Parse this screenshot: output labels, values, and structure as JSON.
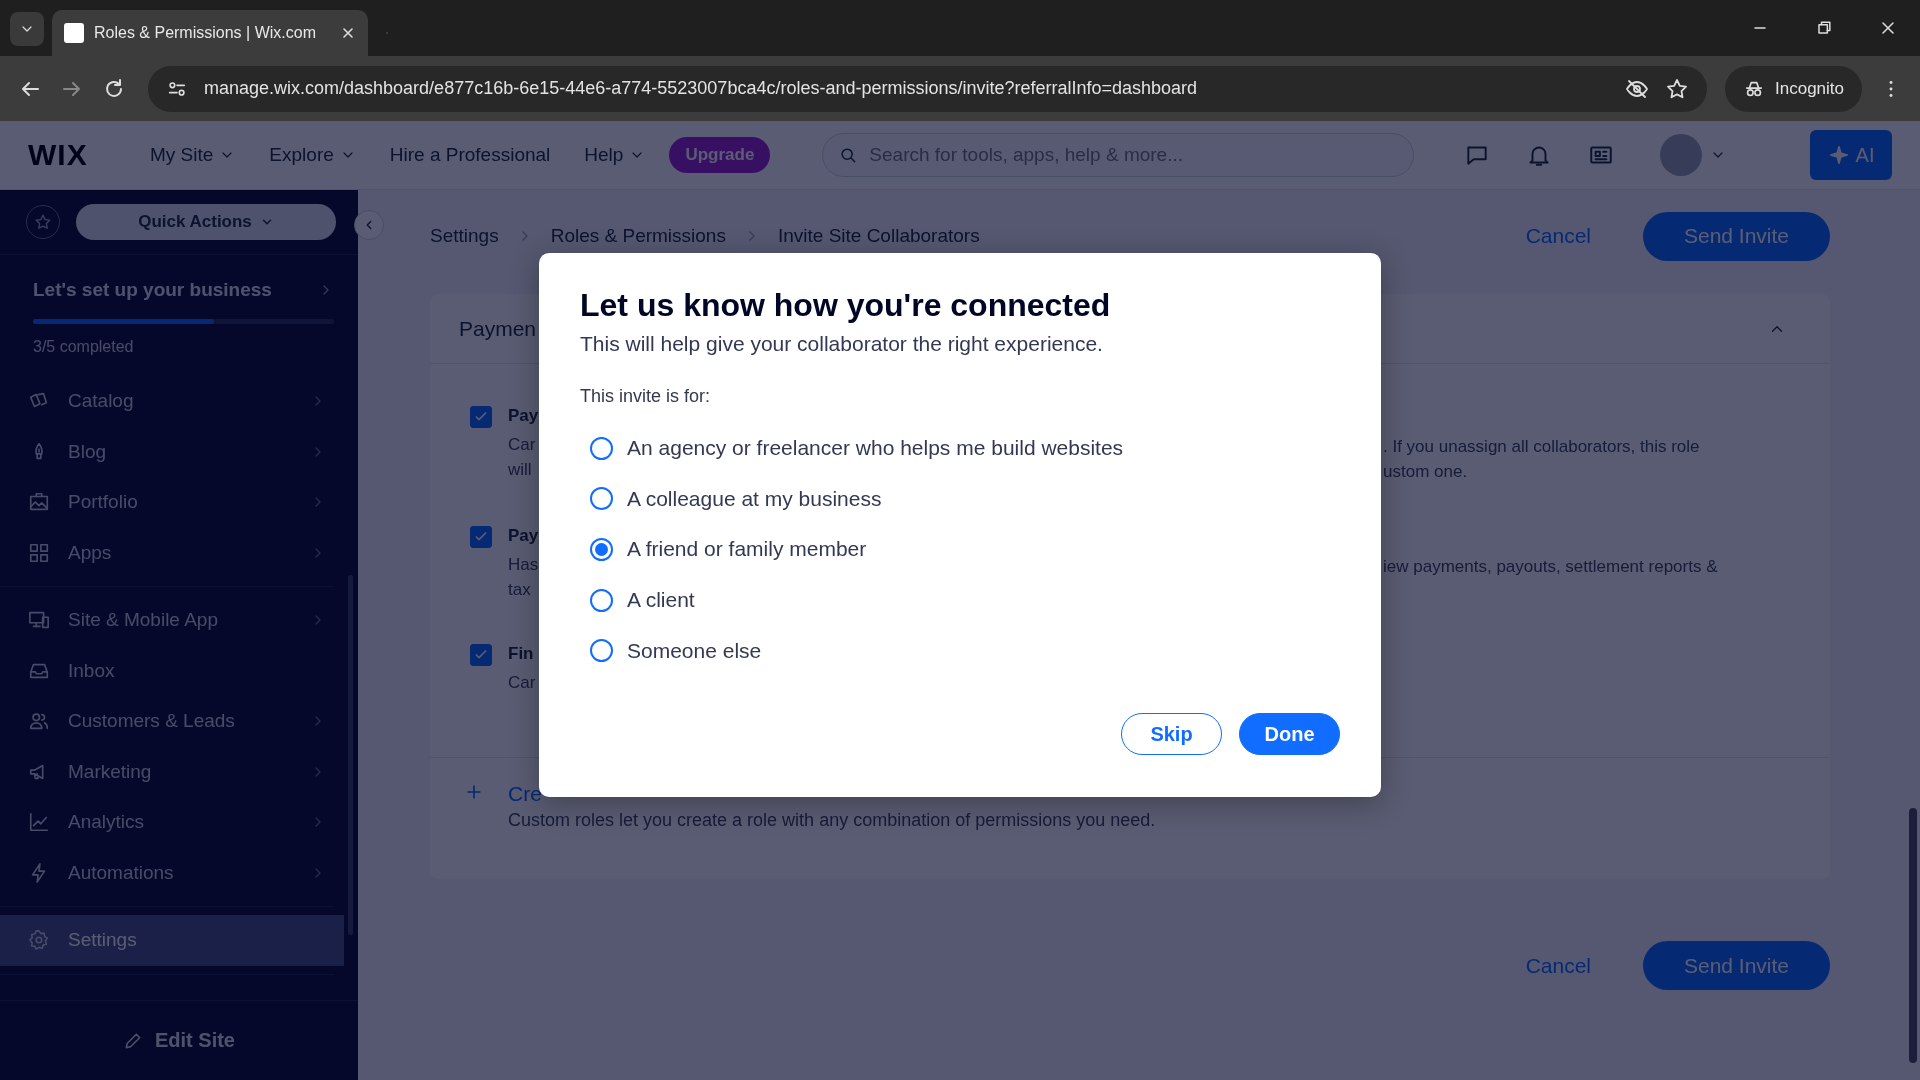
{
  "browser": {
    "tab": {
      "title": "Roles & Permissions | Wix.com"
    },
    "address": "manage.wix.com/dashboard/e877c16b-6e15-44e6-a774-5523007bca4c/roles-and-permissions/invite?referralInfo=dashboard",
    "incognito": "Incognito"
  },
  "header": {
    "logo": "WIX",
    "nav": [
      {
        "label": "My Site",
        "dropdown": true
      },
      {
        "label": "Explore",
        "dropdown": true
      },
      {
        "label": "Hire a Professional",
        "dropdown": false
      },
      {
        "label": "Help",
        "dropdown": true
      }
    ],
    "upgrade": "Upgrade",
    "search": {
      "placeholder": "Search for tools, apps, help & more..."
    },
    "ai_button": "AI"
  },
  "sidebar": {
    "quick_actions": "Quick Actions",
    "setup": {
      "title": "Let's set up your business",
      "level": 0.6,
      "progress": "3/5 completed"
    },
    "groups": [
      [
        {
          "label": "Catalog",
          "chevron": true,
          "selected": false
        },
        {
          "label": "Blog",
          "chevron": true,
          "selected": false
        },
        {
          "label": "Portfolio",
          "chevron": true,
          "selected": false
        },
        {
          "label": "Apps",
          "chevron": true,
          "selected": false
        }
      ],
      [
        {
          "label": "Site & Mobile App",
          "chevron": true,
          "selected": false
        },
        {
          "label": "Inbox",
          "chevron": false,
          "selected": false
        },
        {
          "label": "Customers & Leads",
          "chevron": true,
          "selected": false
        },
        {
          "label": "Marketing",
          "chevron": true,
          "selected": false
        },
        {
          "label": "Analytics",
          "chevron": true,
          "selected": false
        },
        {
          "label": "Automations",
          "chevron": true,
          "selected": false
        }
      ],
      [
        {
          "label": "Settings",
          "chevron": false,
          "selected": true
        }
      ]
    ],
    "edit_site": "Edit Site"
  },
  "breadcrumbs": [
    "Settings",
    "Roles & Permissions",
    "Invite Site Collaborators"
  ],
  "top_actions": {
    "cancel": "Cancel",
    "send": "Send Invite"
  },
  "section": {
    "title": "Paymen",
    "rows": [
      {
        "checked": true,
        "title": "Pay",
        "desc_left": [
          "Car",
          "will"
        ],
        "desc_right": [
          ". If you unassign all collaborators, this role",
          "ustom one."
        ]
      },
      {
        "checked": true,
        "title": "Pay",
        "desc_left": [
          "Has",
          "tax"
        ],
        "desc_right": [
          "iew payments, payouts, settlement reports &"
        ]
      },
      {
        "checked": true,
        "title": "Fin",
        "desc_left": [
          "Car"
        ],
        "desc_right": []
      }
    ],
    "create": {
      "label": "Cre",
      "desc": "Custom roles let you create a role with any combination of permissions you need."
    }
  },
  "bottom_actions": {
    "cancel": "Cancel",
    "send": "Send Invite"
  },
  "modal": {
    "title": "Let us know how you're connected",
    "subtitle": "This will help give your collaborator the right experience.",
    "question": "This invite is for:",
    "options": [
      {
        "label": "An agency or freelancer who helps me build websites",
        "selected": false
      },
      {
        "label": "A colleague at my business",
        "selected": false
      },
      {
        "label": "A friend or family member",
        "selected": true
      },
      {
        "label": "A client",
        "selected": false
      },
      {
        "label": "Someone else",
        "selected": false
      }
    ],
    "buttons": [
      {
        "label": "Skip",
        "kind": "secondary"
      },
      {
        "label": "Done",
        "kind": "primary"
      }
    ]
  }
}
